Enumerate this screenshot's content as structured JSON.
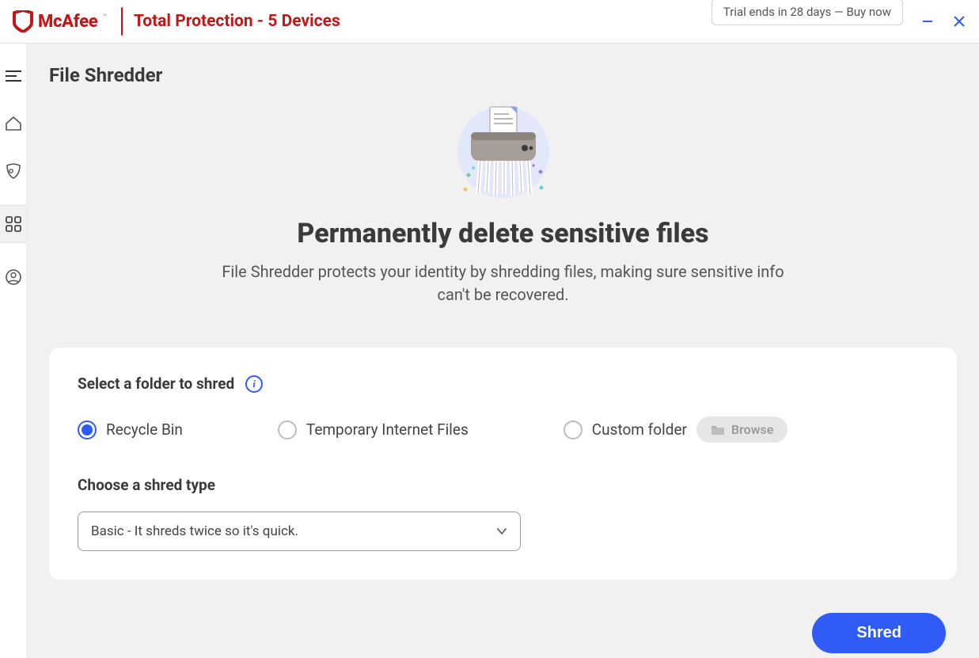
{
  "brand": {
    "name": "McAfee",
    "product": "Total Protection - 5 Devices"
  },
  "titlebar": {
    "trial": "Trial ends in 28 days — Buy now"
  },
  "page": {
    "title": "File Shredder",
    "heading": "Permanently delete sensitive files",
    "sub": "File Shredder protects your identity by shredding files, making sure sensitive info can't be recovered."
  },
  "card": {
    "select_label": "Select a folder to shred",
    "options": [
      {
        "label": "Recycle Bin",
        "selected": true
      },
      {
        "label": "Temporary Internet Files",
        "selected": false
      },
      {
        "label": "Custom folder",
        "selected": false
      }
    ],
    "browse_label": "Browse",
    "type_label": "Choose a shred type",
    "type_value": "Basic - It shreds twice so it's quick."
  },
  "action": {
    "primary": "Shred"
  },
  "colors": {
    "brand_red": "#C01818",
    "accent_blue": "#2F5CF6"
  }
}
